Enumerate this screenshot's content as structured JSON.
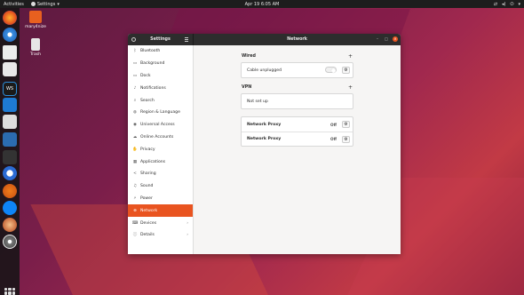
{
  "topbar": {
    "activities": "Activities",
    "app": "Settings",
    "clock": "Apr 19  6:05 AM"
  },
  "desktop": {
    "home_label": "mary4nize",
    "trash_label": "Trash"
  },
  "window": {
    "sidebar_title": "Settings",
    "title": "Network",
    "sidebar": [
      {
        "label": "Bluetooth",
        "icon": "ᛒ"
      },
      {
        "label": "Background",
        "icon": "▭"
      },
      {
        "label": "Dock",
        "icon": "▭"
      },
      {
        "label": "Notifications",
        "icon": "♪"
      },
      {
        "label": "Search",
        "icon": "⌕"
      },
      {
        "label": "Region & Language",
        "icon": "◍"
      },
      {
        "label": "Universal Access",
        "icon": "◉"
      },
      {
        "label": "Online Accounts",
        "icon": "☁"
      },
      {
        "label": "Privacy",
        "icon": "✋"
      },
      {
        "label": "Applications",
        "icon": "▦"
      },
      {
        "label": "Sharing",
        "icon": "<"
      },
      {
        "label": "Sound",
        "icon": "♫"
      },
      {
        "label": "Power",
        "icon": "⚡"
      },
      {
        "label": "Network",
        "icon": "⊕"
      },
      {
        "label": "Devices",
        "icon": "⌨"
      },
      {
        "label": "Details",
        "icon": "ⓘ"
      }
    ],
    "wired": {
      "heading": "Wired",
      "row": "Cable unplugged"
    },
    "vpn": {
      "heading": "VPN",
      "row": "Not set up"
    },
    "proxy1": {
      "label": "Network Proxy",
      "state": "Off"
    },
    "proxy2": {
      "label": "Network Proxy",
      "state": "Off"
    }
  }
}
